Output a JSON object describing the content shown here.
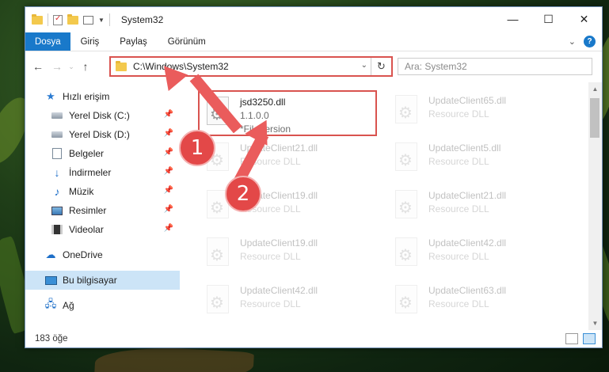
{
  "window": {
    "title": "System32",
    "controls": {
      "minimize": "—",
      "maximize": "☐",
      "close": "✕"
    }
  },
  "ribbon": {
    "tabs": [
      "Dosya",
      "Giriş",
      "Paylaş",
      "Görünüm"
    ],
    "help_label": "?"
  },
  "navigation": {
    "address": "C:\\Windows\\System32",
    "search_placeholder": "Ara: System32"
  },
  "sidebar": {
    "quick_access": "Hızlı erişim",
    "items": [
      {
        "label": "Yerel Disk (C:)",
        "icon": "drive-icon"
      },
      {
        "label": "Yerel Disk (D:)",
        "icon": "drive-icon"
      },
      {
        "label": "Belgeler",
        "icon": "documents-icon"
      },
      {
        "label": "İndirmeler",
        "icon": "downloads-icon"
      },
      {
        "label": "Müzik",
        "icon": "music-icon"
      },
      {
        "label": "Resimler",
        "icon": "pictures-icon"
      },
      {
        "label": "Videolar",
        "icon": "videos-icon"
      }
    ],
    "onedrive": "OneDrive",
    "this_pc": "Bu bilgisayar",
    "network": "Ağ"
  },
  "files": {
    "highlighted": {
      "name": "jsd3250.dll",
      "version": "1.1.0.0",
      "desc": "*FileVersion"
    },
    "left_column": [
      {
        "name": "UpdateClient21.dll",
        "type": "Resource DLL"
      },
      {
        "name": "UpdateClient19.dll",
        "type": "Resource DLL"
      },
      {
        "name": "UpdateClient19.dll",
        "type": "Resource DLL"
      },
      {
        "name": "UpdateClient42.dll",
        "type": "Resource DLL"
      }
    ],
    "right_column": [
      {
        "name": "UpdateClient65.dll",
        "type": "Resource DLL"
      },
      {
        "name": "UpdateClient5.dll",
        "type": "Resource DLL"
      },
      {
        "name": "UpdateClient21.dll",
        "type": "Resource DLL"
      },
      {
        "name": "UpdateClient42.dll",
        "type": "Resource DLL"
      },
      {
        "name": "UpdateClient63.dll",
        "type": "Resource DLL"
      }
    ]
  },
  "status": {
    "count": "183 öğe"
  },
  "callouts": {
    "one": "1",
    "two": "2"
  }
}
